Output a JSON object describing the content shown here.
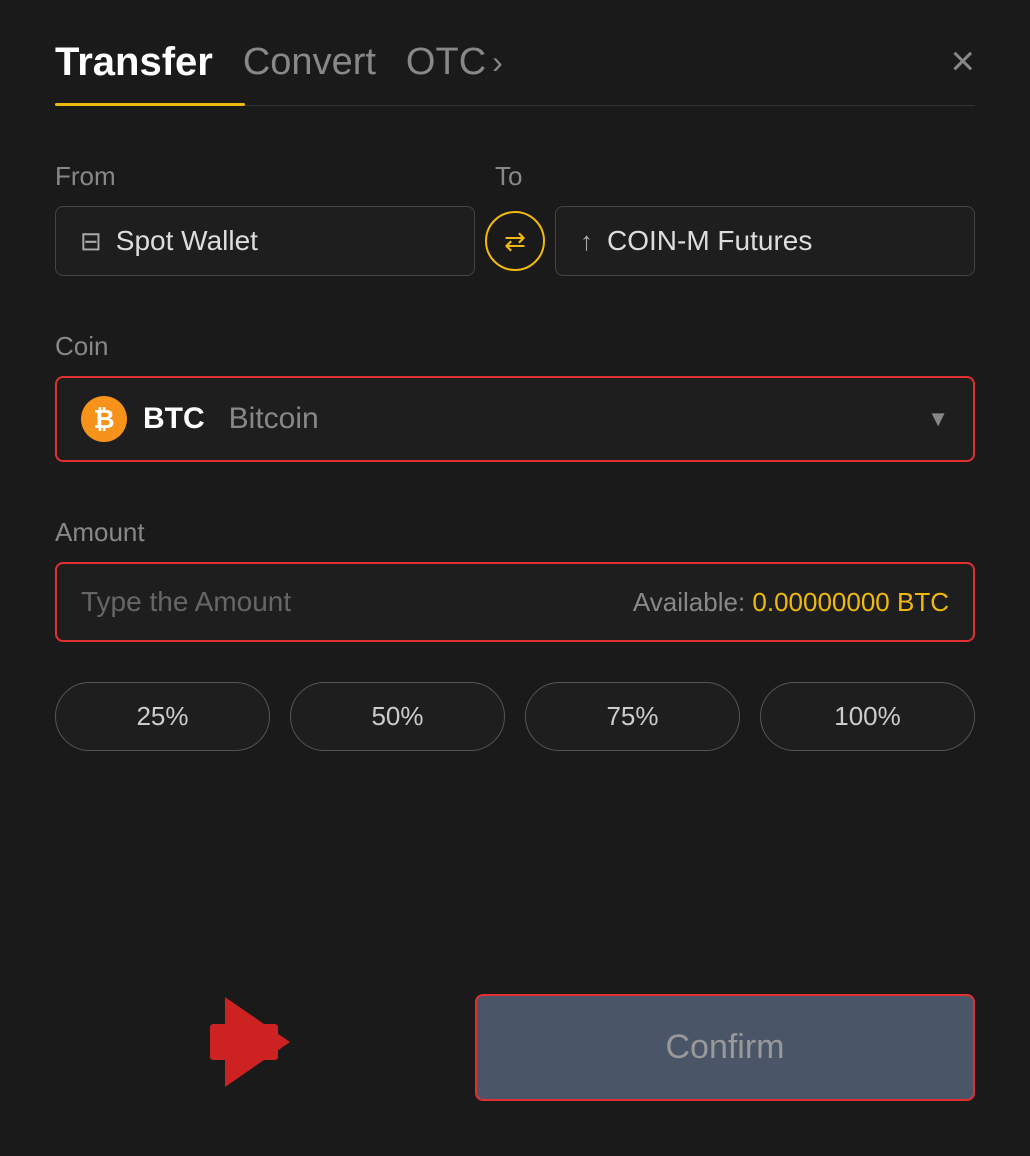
{
  "header": {
    "tab_transfer": "Transfer",
    "tab_convert": "Convert",
    "tab_otc": "OTC",
    "close_label": "×"
  },
  "from_section": {
    "label": "From",
    "wallet_name": "Spot Wallet"
  },
  "to_section": {
    "label": "To",
    "futures_name": "COIN-M Futures"
  },
  "coin_section": {
    "label": "Coin",
    "coin_symbol": "BTC",
    "coin_name": "Bitcoin"
  },
  "amount_section": {
    "label": "Amount",
    "placeholder": "Type the Amount",
    "available_label": "Available:",
    "available_amount": "0.00000000 BTC"
  },
  "pct_buttons": {
    "btn25": "25%",
    "btn50": "50%",
    "btn75": "75%",
    "btn100": "100%"
  },
  "confirm_button": {
    "label": "Confirm"
  }
}
